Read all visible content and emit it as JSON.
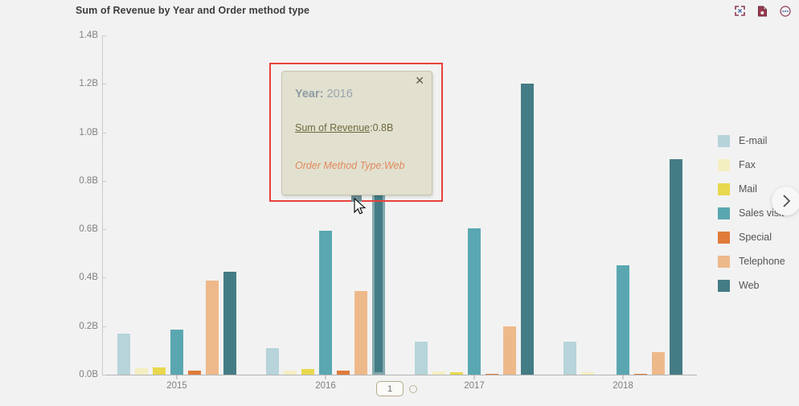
{
  "header": {
    "title": "Sum of Revenue by Year and Order method type",
    "toolbar": [
      {
        "name": "expand-icon",
        "label": "Expand"
      },
      {
        "name": "export-document-icon",
        "label": "Export"
      },
      {
        "name": "more-options-icon",
        "label": "More options"
      }
    ]
  },
  "tooltip": {
    "year_key": "Year:",
    "year_value": "2016",
    "measure_key": "Sum of Revenue",
    "measure_value": ":0.8B",
    "category_text": "Order Method Type:Web",
    "close_label": "✕"
  },
  "pager": {
    "current": "1",
    "next_arrow": "›"
  },
  "legend": {
    "position": "right",
    "items": [
      {
        "label": "E-mail",
        "color": "#b6d4da"
      },
      {
        "label": "Fax",
        "color": "#f4eec3"
      },
      {
        "label": "Mail",
        "color": "#e8d84d"
      },
      {
        "label": "Sales visit",
        "color": "#5aa7b1"
      },
      {
        "label": "Special",
        "color": "#e07b39"
      },
      {
        "label": "Telephone",
        "color": "#eeb98a"
      },
      {
        "label": "Web",
        "color": "#447c85"
      }
    ]
  },
  "chart_data": {
    "type": "bar",
    "title": "Sum of Revenue by Year and Order method type",
    "xlabel": "",
    "ylabel": "",
    "categories": [
      "2015",
      "2016",
      "2017",
      "2018"
    ],
    "ytick_labels": [
      "0.0B",
      "0.2B",
      "0.4B",
      "0.6B",
      "0.8B",
      "1.0B",
      "1.2B",
      "1.4B"
    ],
    "ytick_values": [
      0,
      0.2,
      0.4,
      0.6,
      0.8,
      1.0,
      1.2,
      1.4
    ],
    "ylim": [
      0,
      1.4
    ],
    "grid": false,
    "units": "B",
    "series": [
      {
        "name": "E-mail",
        "color": "#b6d4da",
        "values": [
          0.17,
          0.11,
          0.135,
          0.135
        ]
      },
      {
        "name": "Fax",
        "color": "#f4eec3",
        "values": [
          0.025,
          0.018,
          0.012,
          0.009
        ]
      },
      {
        "name": "Mail",
        "color": "#e8d84d",
        "values": [
          0.029,
          0.022,
          0.009,
          0.0
        ]
      },
      {
        "name": "Sales visit",
        "color": "#5aa7b1",
        "values": [
          0.185,
          0.595,
          0.603,
          0.452
        ]
      },
      {
        "name": "Special",
        "color": "#e07b39",
        "values": [
          0.018,
          0.017,
          0.004,
          0.004
        ]
      },
      {
        "name": "Telephone",
        "color": "#eeb98a",
        "values": [
          0.387,
          0.345,
          0.199,
          0.092
        ]
      },
      {
        "name": "Web",
        "color": "#447c85",
        "values": [
          0.423,
          0.8,
          1.2,
          0.888
        ]
      }
    ],
    "highlighted_point": {
      "category": "2016",
      "series": "Web",
      "value": 0.8
    }
  }
}
